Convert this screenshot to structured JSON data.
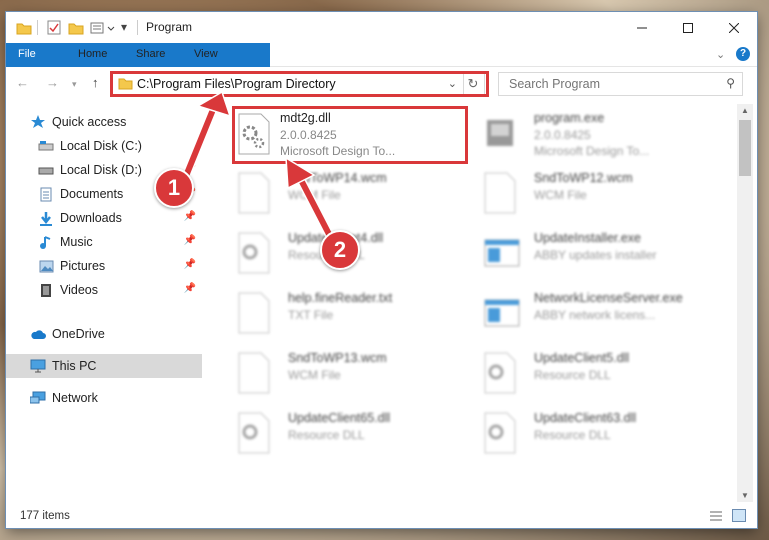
{
  "window": {
    "title": "Program"
  },
  "ribbon": {
    "tabs": [
      "File",
      "Home",
      "Share",
      "View"
    ]
  },
  "address": {
    "path": "C:\\Program Files\\Program Directory"
  },
  "search": {
    "placeholder": "Search Program"
  },
  "sidebar": {
    "items": [
      {
        "label": "Quick access",
        "icon": "star-icon"
      },
      {
        "label": "Local Disk (C:)",
        "icon": "drive-icon"
      },
      {
        "label": "Local Disk (D:)",
        "icon": "drive-icon"
      },
      {
        "label": "Documents",
        "icon": "documents-icon"
      },
      {
        "label": "Downloads",
        "icon": "downloads-icon"
      },
      {
        "label": "Music",
        "icon": "music-icon"
      },
      {
        "label": "Pictures",
        "icon": "pictures-icon"
      },
      {
        "label": "Videos",
        "icon": "videos-icon"
      },
      {
        "label": "OneDrive",
        "icon": "cloud-icon"
      },
      {
        "label": "This PC",
        "icon": "computer-icon"
      },
      {
        "label": "Network",
        "icon": "network-icon"
      }
    ]
  },
  "files": [
    {
      "name": "mdt2g.dll",
      "line2": "2.0.0.8425",
      "line3": "Microsoft Design To...",
      "icon": "dll-icon",
      "highlighted": true
    },
    {
      "name": "program.exe",
      "line2": "2.0.0.8425",
      "line3": "Microsoft Design To...",
      "icon": "exe-icon"
    },
    {
      "name": "SndToWP14.wcm",
      "line2": "WCM File",
      "line3": "",
      "icon": "file-icon"
    },
    {
      "name": "SndToWP12.wcm",
      "line2": "WCM File",
      "line3": "",
      "icon": "file-icon"
    },
    {
      "name": "UpdateClient4.dll",
      "line2": "Resource DLL",
      "line3": "",
      "icon": "dll-icon"
    },
    {
      "name": "UpdateInstaller.exe",
      "line2": "ABBY updates installer",
      "line3": "",
      "icon": "window-icon"
    },
    {
      "name": "help.fineReader.txt",
      "line2": "TXT File",
      "line3": "",
      "icon": "file-icon"
    },
    {
      "name": "NetworkLicenseServer.exe",
      "line2": "ABBY network licens...",
      "line3": "",
      "icon": "window-icon"
    },
    {
      "name": "SndToWP13.wcm",
      "line2": "WCM File",
      "line3": "",
      "icon": "file-icon"
    },
    {
      "name": "UpdateClient5.dll",
      "line2": "Resource DLL",
      "line3": "",
      "icon": "dll-icon"
    },
    {
      "name": "UpdateClient65.dll",
      "line2": "Resource DLL",
      "line3": "",
      "icon": "dll-icon"
    },
    {
      "name": "UpdateClient63.dll",
      "line2": "Resource DLL",
      "line3": "",
      "icon": "dll-icon"
    }
  ],
  "status": {
    "item_count": "177 items"
  },
  "callouts": [
    "1",
    "2"
  ],
  "colors": {
    "accent": "#1979ca",
    "highlight": "#d9383a"
  }
}
